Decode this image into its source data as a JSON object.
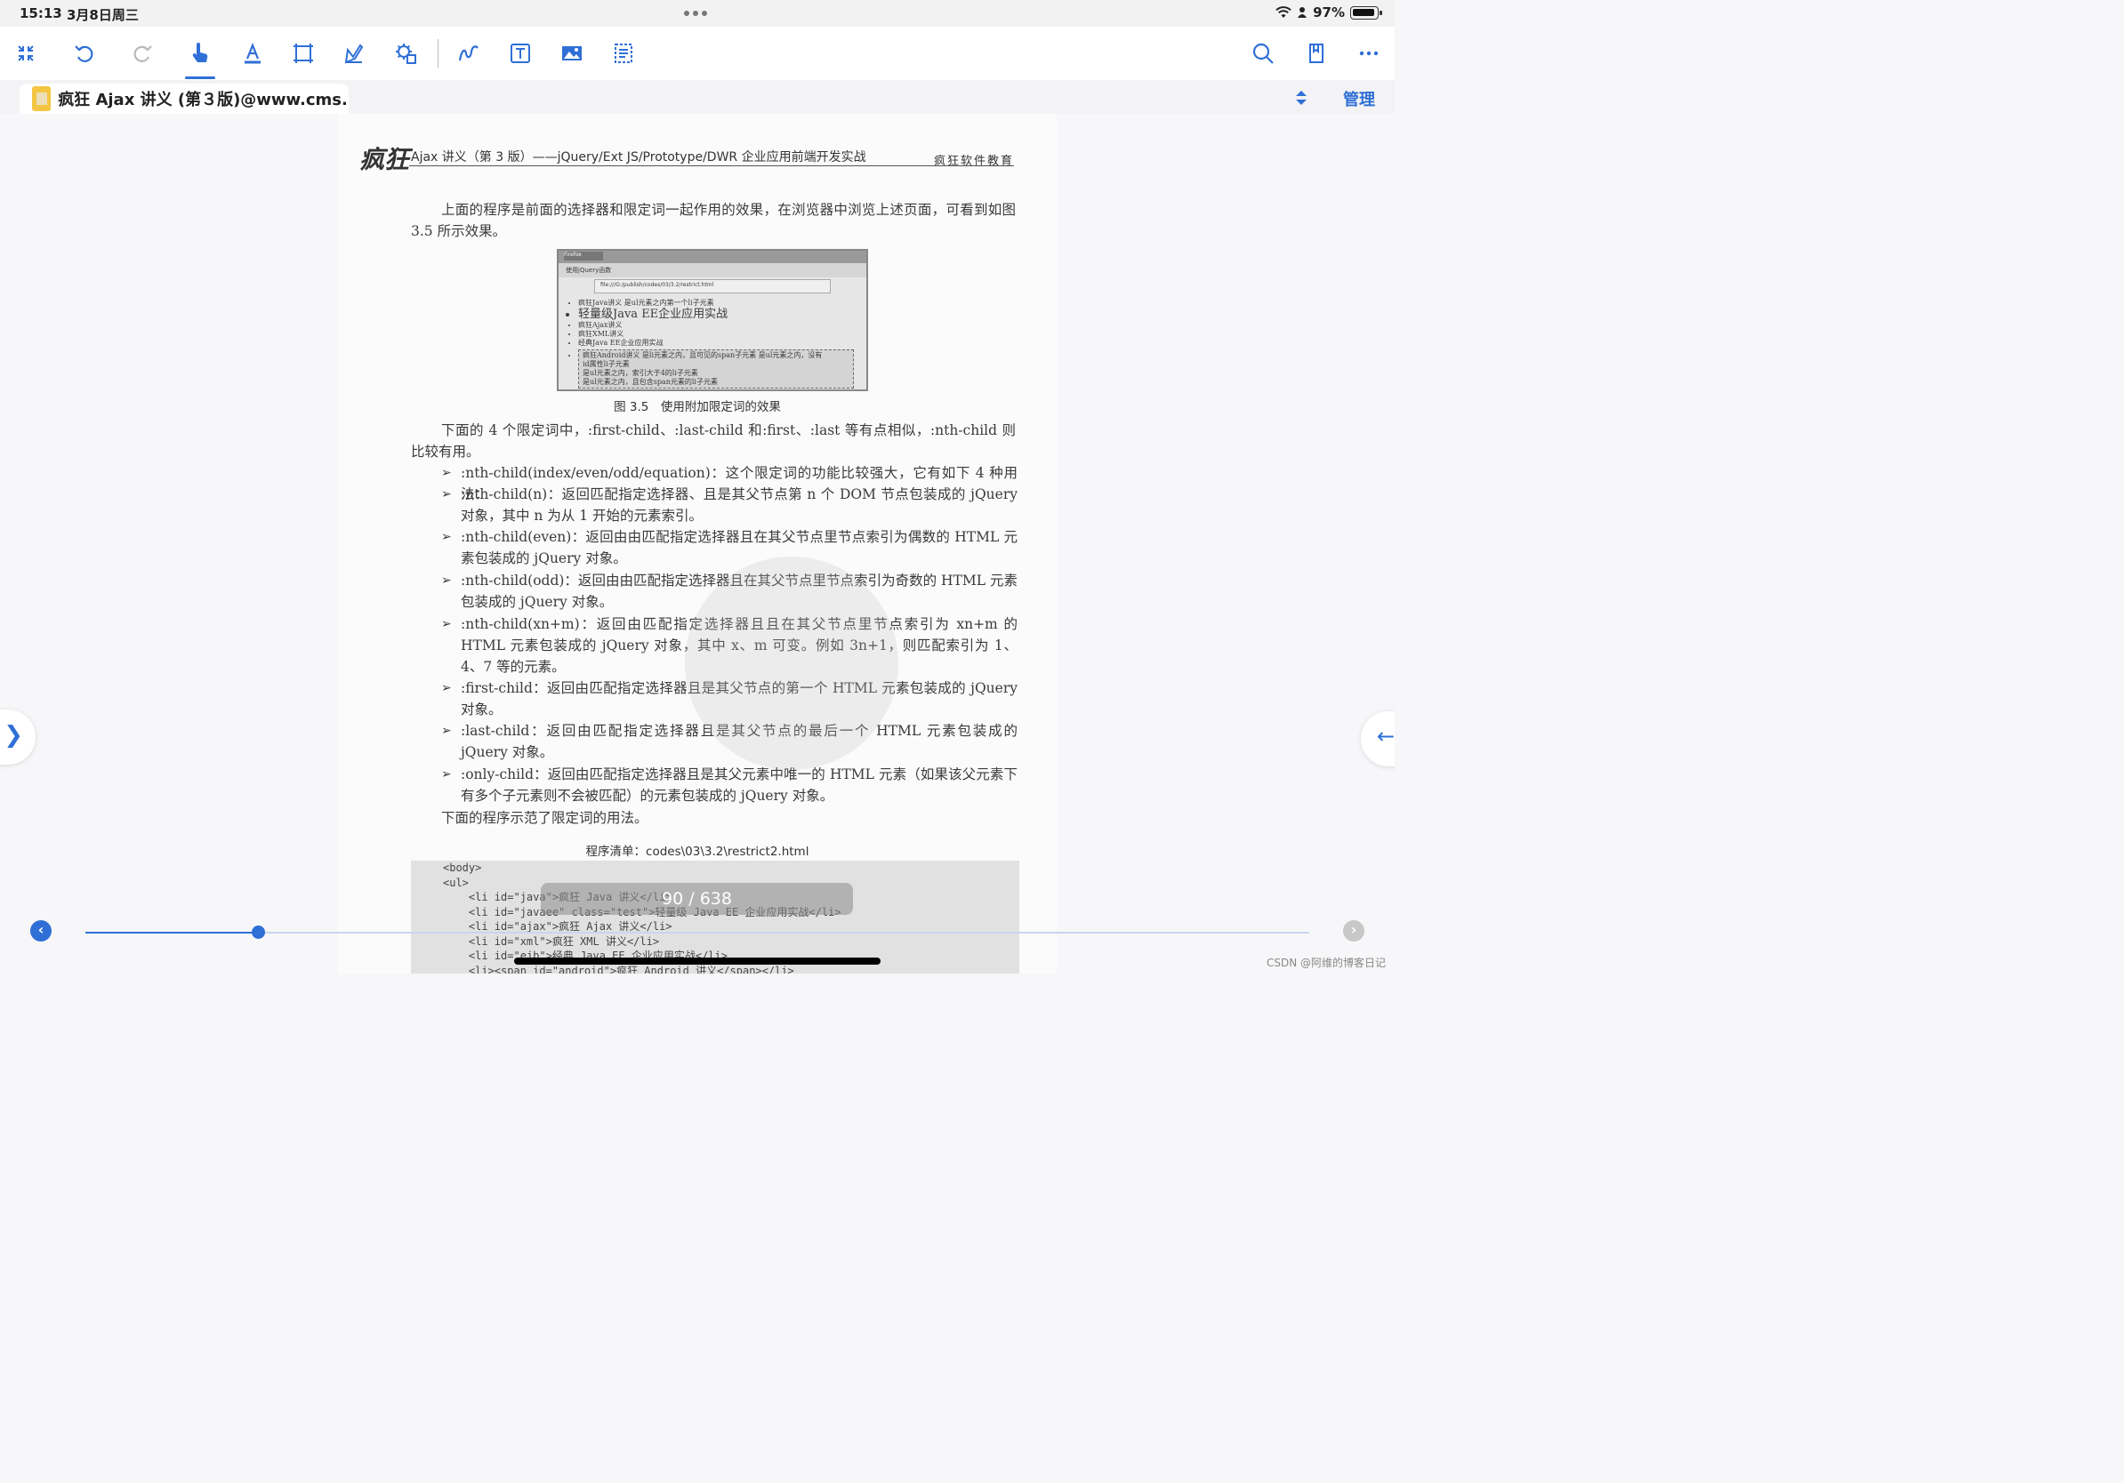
{
  "status_bar": {
    "time": "15:13",
    "date": "3月8日周三",
    "battery_pct": "97%"
  },
  "toolbar": {
    "icons": [
      "collapse-icon",
      "undo-icon",
      "redo-icon",
      "hand-pointer-icon",
      "text-highlight-icon",
      "crop-icon",
      "signature-icon",
      "stamp-settings-icon",
      "freehand-draw-icon",
      "text-box-icon",
      "image-icon",
      "select-text-icon",
      "search-icon",
      "bookmark-icon",
      "more-icon"
    ],
    "active_tool": "hand-pointer-icon",
    "accent_color": "#2f6fd6"
  },
  "tab": {
    "title": "疯狂 Ajax 讲义 (第３版)@www.cms...",
    "manage_label": "管理"
  },
  "document": {
    "header_logo": "疯狂",
    "header_title": "Ajax 讲义（第 3 版）——jQuery/Ext JS/Prototype/DWR 企业应用前端开发实战",
    "header_right": "疯狂软件教育",
    "para1": "上面的程序是前面的选择器和限定词一起作用的效果，在浏览器中浏览上述页面，可看到如图 3.5 所示效果。",
    "figure": {
      "browser_label": "Firefox",
      "tab_label": "使用jQuery函数",
      "address": "file:///G:/publish/codes/03/3.2/restrict.html",
      "items": [
        "疯狂Java讲义 是ul元素之内第一个li子元素",
        "轻量级Java EE企业应用实战",
        "疯狂Ajax讲义",
        "疯狂XML讲义",
        "经典Java EE企业应用实战",
        "疯狂Android讲义 是li元素之内，且可见的span子元素 是ul元素之内，没有",
        "id属性li子元素",
        "是ul元素之内，索引大于4的li子元素",
        "是ul元素之内，且包含span元素的li子元素"
      ],
      "caption": "图 3.5　使用附加限定词的效果"
    },
    "para2": "下面的 4 个限定词中，:first-child、:last-child 和:first、:last 等有点相似，:nth-child 则比较有用。",
    "bullets": [
      ":nth-child(index/even/odd/equation)：这个限定词的功能比较强大，它有如下 4 种用法：",
      ":nth-child(n)：返回匹配指定选择器、且是其父节点第 n 个 DOM 节点包装成的 jQuery 对象，其中 n 为从 1 开始的元素索引。",
      ":nth-child(even)：返回由由匹配指定选择器且在其父节点里节点索引为偶数的 HTML 元素包装成的 jQuery 对象。",
      ":nth-child(odd)：返回由由匹配指定选择器且在其父节点里节点索引为奇数的 HTML 元素包装成的 jQuery 对象。",
      ":nth-child(xn+m)：返回由匹配指定选择器且且在其父节点里节点索引为 xn+m 的 HTML 元素包装成的 jQuery 对象，其中 x、m 可变。例如 3n+1，则匹配索引为 1、4、7 等的元素。",
      ":first-child：返回由匹配指定选择器且是其父节点的第一个 HTML 元素包装成的 jQuery 对象。",
      ":last-child：返回由匹配指定选择器且是其父节点的最后一个 HTML 元素包装成的 jQuery 对象。",
      ":only-child：返回由匹配指定选择器且是其父元素中唯一的 HTML 元素（如果该父元素下有多个子元素则不会被匹配）的元素包装成的 jQuery 对象。"
    ],
    "para3": "下面的程序示范了限定词的用法。",
    "program_title": "程序清单：codes\\03\\3.2\\restrict2.html",
    "code_lines": [
      "<body>",
      "<ul>",
      "    <li id=\"java\">疯狂 Java 讲义</li>",
      "    <li id=\"javaee\" class=\"test\">轻量级 Java EE 企业应用实战</li>",
      "    <li id=\"ajax\">疯狂 Ajax 讲义</li>",
      "    <li id=\"xml\">疯狂 XML 讲义</li>",
      "    <li id=\"ejb\">经典 Java EE 企业应用实战</li>",
      "    <li><span id=\"android\">疯狂 Android 讲义</span></li>"
    ]
  },
  "navigation": {
    "page_indicator": "90 / 638",
    "current_page": 90,
    "total_pages": 638,
    "progress_fraction": 0.141
  },
  "footer": {
    "watermark_text": "CSDN @阿维的博客日记"
  }
}
